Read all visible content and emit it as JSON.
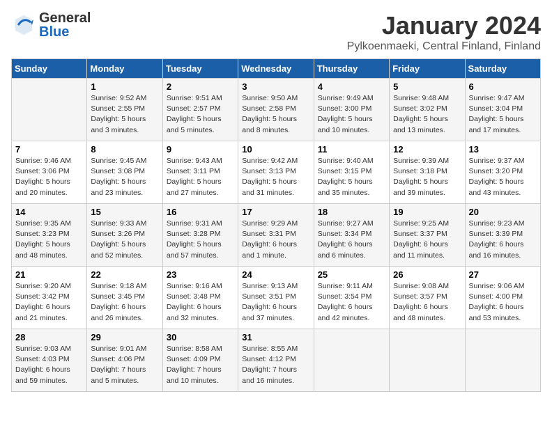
{
  "header": {
    "logo_general": "General",
    "logo_blue": "Blue",
    "month": "January 2024",
    "location": "Pylkoenmaeki, Central Finland, Finland"
  },
  "days_of_week": [
    "Sunday",
    "Monday",
    "Tuesday",
    "Wednesday",
    "Thursday",
    "Friday",
    "Saturday"
  ],
  "weeks": [
    [
      {
        "day": "",
        "details": ""
      },
      {
        "day": "1",
        "details": "Sunrise: 9:52 AM\nSunset: 2:55 PM\nDaylight: 5 hours\nand 3 minutes."
      },
      {
        "day": "2",
        "details": "Sunrise: 9:51 AM\nSunset: 2:57 PM\nDaylight: 5 hours\nand 5 minutes."
      },
      {
        "day": "3",
        "details": "Sunrise: 9:50 AM\nSunset: 2:58 PM\nDaylight: 5 hours\nand 8 minutes."
      },
      {
        "day": "4",
        "details": "Sunrise: 9:49 AM\nSunset: 3:00 PM\nDaylight: 5 hours\nand 10 minutes."
      },
      {
        "day": "5",
        "details": "Sunrise: 9:48 AM\nSunset: 3:02 PM\nDaylight: 5 hours\nand 13 minutes."
      },
      {
        "day": "6",
        "details": "Sunrise: 9:47 AM\nSunset: 3:04 PM\nDaylight: 5 hours\nand 17 minutes."
      }
    ],
    [
      {
        "day": "7",
        "details": "Sunrise: 9:46 AM\nSunset: 3:06 PM\nDaylight: 5 hours\nand 20 minutes."
      },
      {
        "day": "8",
        "details": "Sunrise: 9:45 AM\nSunset: 3:08 PM\nDaylight: 5 hours\nand 23 minutes."
      },
      {
        "day": "9",
        "details": "Sunrise: 9:43 AM\nSunset: 3:11 PM\nDaylight: 5 hours\nand 27 minutes."
      },
      {
        "day": "10",
        "details": "Sunrise: 9:42 AM\nSunset: 3:13 PM\nDaylight: 5 hours\nand 31 minutes."
      },
      {
        "day": "11",
        "details": "Sunrise: 9:40 AM\nSunset: 3:15 PM\nDaylight: 5 hours\nand 35 minutes."
      },
      {
        "day": "12",
        "details": "Sunrise: 9:39 AM\nSunset: 3:18 PM\nDaylight: 5 hours\nand 39 minutes."
      },
      {
        "day": "13",
        "details": "Sunrise: 9:37 AM\nSunset: 3:20 PM\nDaylight: 5 hours\nand 43 minutes."
      }
    ],
    [
      {
        "day": "14",
        "details": "Sunrise: 9:35 AM\nSunset: 3:23 PM\nDaylight: 5 hours\nand 48 minutes."
      },
      {
        "day": "15",
        "details": "Sunrise: 9:33 AM\nSunset: 3:26 PM\nDaylight: 5 hours\nand 52 minutes."
      },
      {
        "day": "16",
        "details": "Sunrise: 9:31 AM\nSunset: 3:28 PM\nDaylight: 5 hours\nand 57 minutes."
      },
      {
        "day": "17",
        "details": "Sunrise: 9:29 AM\nSunset: 3:31 PM\nDaylight: 6 hours\nand 1 minute."
      },
      {
        "day": "18",
        "details": "Sunrise: 9:27 AM\nSunset: 3:34 PM\nDaylight: 6 hours\nand 6 minutes."
      },
      {
        "day": "19",
        "details": "Sunrise: 9:25 AM\nSunset: 3:37 PM\nDaylight: 6 hours\nand 11 minutes."
      },
      {
        "day": "20",
        "details": "Sunrise: 9:23 AM\nSunset: 3:39 PM\nDaylight: 6 hours\nand 16 minutes."
      }
    ],
    [
      {
        "day": "21",
        "details": "Sunrise: 9:20 AM\nSunset: 3:42 PM\nDaylight: 6 hours\nand 21 minutes."
      },
      {
        "day": "22",
        "details": "Sunrise: 9:18 AM\nSunset: 3:45 PM\nDaylight: 6 hours\nand 26 minutes."
      },
      {
        "day": "23",
        "details": "Sunrise: 9:16 AM\nSunset: 3:48 PM\nDaylight: 6 hours\nand 32 minutes."
      },
      {
        "day": "24",
        "details": "Sunrise: 9:13 AM\nSunset: 3:51 PM\nDaylight: 6 hours\nand 37 minutes."
      },
      {
        "day": "25",
        "details": "Sunrise: 9:11 AM\nSunset: 3:54 PM\nDaylight: 6 hours\nand 42 minutes."
      },
      {
        "day": "26",
        "details": "Sunrise: 9:08 AM\nSunset: 3:57 PM\nDaylight: 6 hours\nand 48 minutes."
      },
      {
        "day": "27",
        "details": "Sunrise: 9:06 AM\nSunset: 4:00 PM\nDaylight: 6 hours\nand 53 minutes."
      }
    ],
    [
      {
        "day": "28",
        "details": "Sunrise: 9:03 AM\nSunset: 4:03 PM\nDaylight: 6 hours\nand 59 minutes."
      },
      {
        "day": "29",
        "details": "Sunrise: 9:01 AM\nSunset: 4:06 PM\nDaylight: 7 hours\nand 5 minutes."
      },
      {
        "day": "30",
        "details": "Sunrise: 8:58 AM\nSunset: 4:09 PM\nDaylight: 7 hours\nand 10 minutes."
      },
      {
        "day": "31",
        "details": "Sunrise: 8:55 AM\nSunset: 4:12 PM\nDaylight: 7 hours\nand 16 minutes."
      },
      {
        "day": "",
        "details": ""
      },
      {
        "day": "",
        "details": ""
      },
      {
        "day": "",
        "details": ""
      }
    ]
  ]
}
